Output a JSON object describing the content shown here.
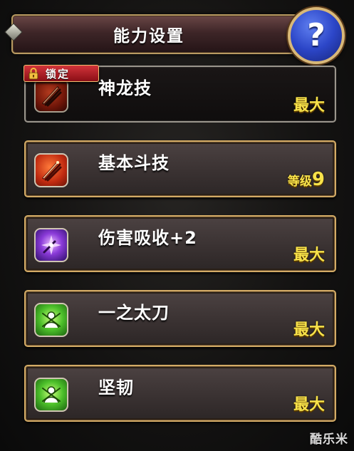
{
  "header": {
    "title": "能力设置",
    "help_label": "?"
  },
  "lock_badge": {
    "label": "锁定"
  },
  "skills": [
    {
      "name": "神龙技",
      "level": "最大",
      "icon": "crossed-swords-icon",
      "color": "darkred",
      "locked": true
    },
    {
      "name": "基本斗技",
      "level_prefix": "等级",
      "level_value": "9",
      "icon": "crossed-swords-icon",
      "color": "red"
    },
    {
      "name": "伤害吸收+2",
      "level": "最大",
      "icon": "shield-burst-icon",
      "color": "purple"
    },
    {
      "name": "一之太刀",
      "level": "最大",
      "icon": "warrior-crest-icon",
      "color": "green"
    },
    {
      "name": "坚韧",
      "level": "最大",
      "icon": "warrior-crest-icon",
      "color": "green"
    }
  ],
  "watermark": "酷乐米",
  "colors": {
    "card_border": "#d3ab66",
    "level_text": "#f7e24a",
    "help_button": "#2c46c8",
    "lock_badge": "#c41e2a"
  }
}
